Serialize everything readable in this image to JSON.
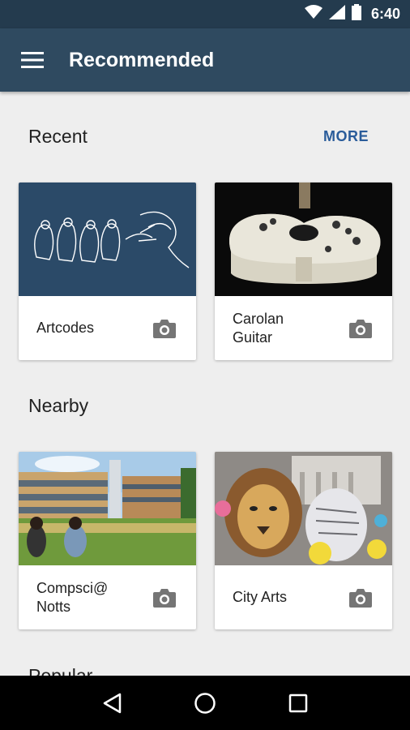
{
  "status_bar": {
    "time": "6:40",
    "icons": [
      "wifi-icon",
      "signal-icon",
      "battery-icon"
    ]
  },
  "app_bar": {
    "title": "Recommended",
    "menu_icon": "menu-icon"
  },
  "sections": {
    "recent": {
      "title": "Recent",
      "more_label": "MORE",
      "cards": [
        {
          "label": "Artcodes",
          "image": "penguins-drawing",
          "action_icon": "camera-icon"
        },
        {
          "label": "Carolan\nGuitar",
          "image": "guitar-photo",
          "action_icon": "camera-icon"
        }
      ]
    },
    "nearby": {
      "title": "Nearby",
      "cards": [
        {
          "label": "Compsci@\nNotts",
          "image": "campus-photo",
          "action_icon": "camera-icon"
        },
        {
          "label": "City Arts",
          "image": "lion-illustration",
          "action_icon": "camera-icon"
        }
      ]
    },
    "popular": {
      "title": "Popular"
    }
  },
  "nav_bar": {
    "icons": [
      "back-icon",
      "home-icon",
      "recents-icon"
    ]
  },
  "colors": {
    "status_bar": "#243b4e",
    "app_bar": "#2f4a60",
    "background": "#eeeeee",
    "accent": "#2a5c9a"
  }
}
